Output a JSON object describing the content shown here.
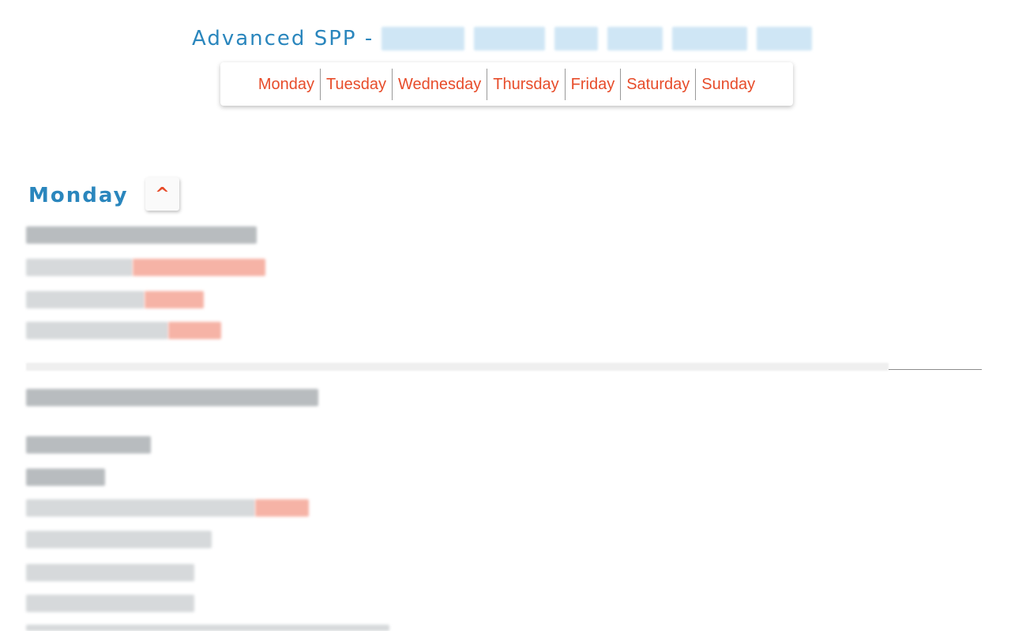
{
  "header": {
    "title": "Advanced SPP - "
  },
  "nav": {
    "days": [
      "Monday",
      "Tuesday",
      "Wednesday",
      "Thursday",
      "Friday",
      "Saturday",
      "Sunday"
    ]
  },
  "section": {
    "heading": "Monday",
    "collapse_icon": "^"
  },
  "colors": {
    "accent_blue": "#2a86bd",
    "link_red": "#e74c2a"
  }
}
